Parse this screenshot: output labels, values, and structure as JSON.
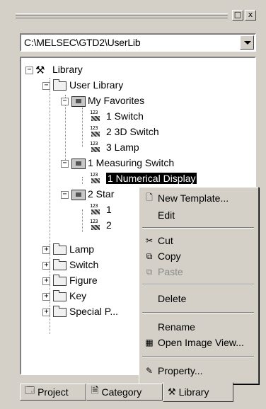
{
  "titlebar": {
    "pin_glyph": "□",
    "close_glyph": "x"
  },
  "combo": {
    "value": "C:\\MELSEC\\GTD2\\UserLib"
  },
  "tree": {
    "root": "Library",
    "user_library": "User Library",
    "my_favorites": "My Favorites",
    "fav_items": [
      "1 Switch",
      "2 3D Switch",
      "3 Lamp"
    ],
    "measuring_switch": "1 Measuring Switch",
    "numerical_display": "1 Numerical Display",
    "standard": "2 Star",
    "std_items": [
      "1",
      "2"
    ],
    "others": [
      "Lamp",
      "Switch",
      "Figure",
      "Key",
      "Special P..."
    ]
  },
  "menu": {
    "new_template": "New Template...",
    "edit": "Edit",
    "cut": "Cut",
    "copy": "Copy",
    "paste": "Paste",
    "delete": "Delete",
    "rename": "Rename",
    "open_image_view": "Open Image View...",
    "property": "Property..."
  },
  "tabs": [
    "Project",
    "Category",
    "Library"
  ]
}
